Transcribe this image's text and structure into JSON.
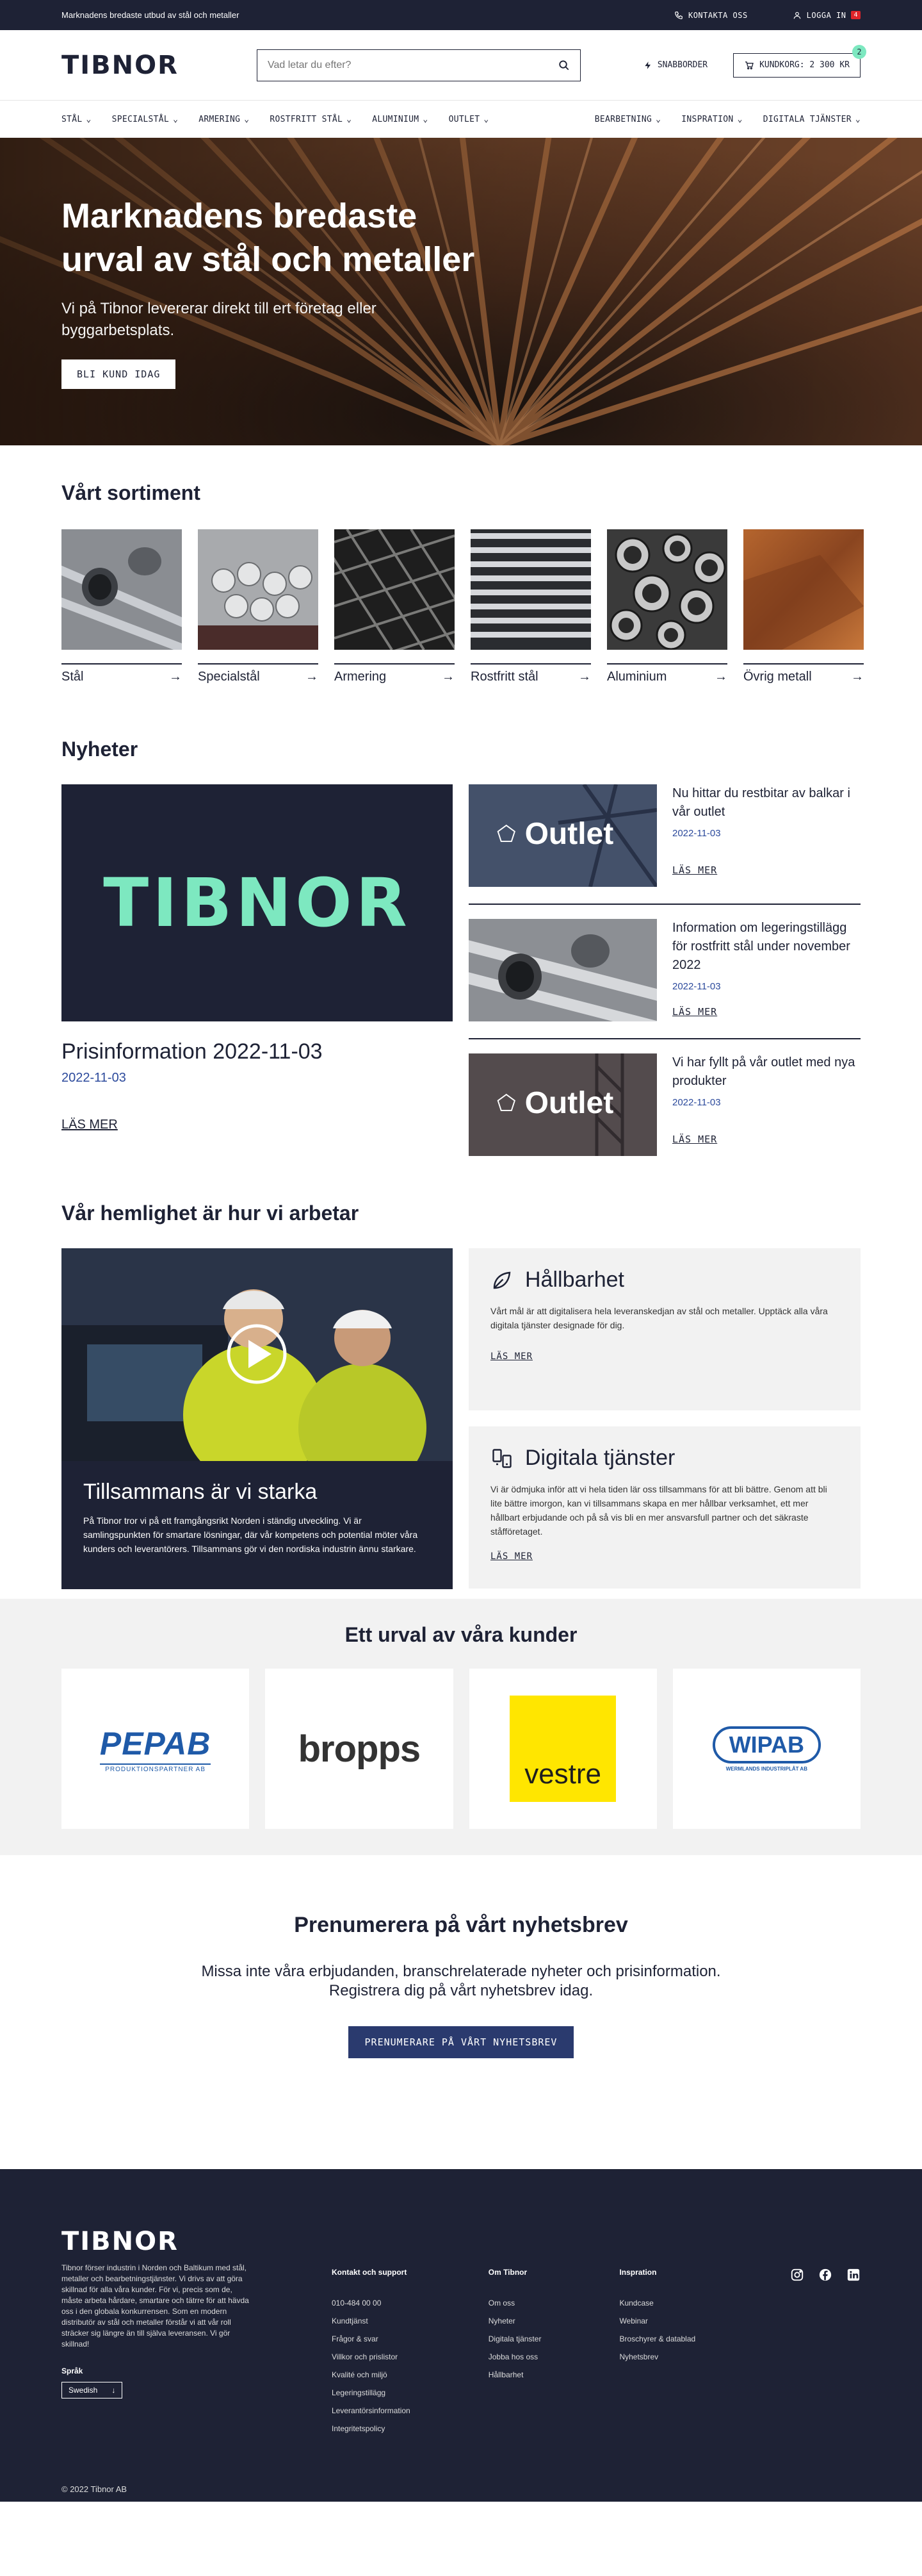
{
  "topbar": {
    "tagline": "Marknadens bredaste utbud av stål och metaller",
    "contact": "KONTAKTA OSS",
    "login": "LOGGA IN",
    "login_badge": "4"
  },
  "header": {
    "logo": "TIBNOR",
    "search_placeholder": "Vad letar du efter?",
    "quick_order": "SNABBORDER",
    "cart_label": "KUNDKORG: 2 300 KR",
    "cart_count": "2"
  },
  "nav": {
    "left": [
      "STÅL",
      "SPECIALSTÅL",
      "ARMERING",
      "ROSTFRITT STÅL",
      "ALUMINIUM",
      "OUTLET"
    ],
    "right": [
      "BEARBETNING",
      "INSPRATION",
      "DIGITALA TJÄNSTER"
    ]
  },
  "hero": {
    "title_1": "Marknadens bredaste",
    "title_2": "urval av stål och metaller",
    "text_1": "Vi på Tibnor levererar direkt till ert företag eller",
    "text_2": "byggarbetsplats.",
    "button": "BLI KUND IDAG"
  },
  "sortiment": {
    "title": "Vårt sortiment",
    "items": [
      "Stål",
      "Specialstål",
      "Armering",
      "Rostfritt stål",
      "Aluminium",
      "Övrig metall"
    ]
  },
  "news": {
    "title": "Nyheter",
    "main": {
      "logo": "TIBNOR",
      "headline": "Prisinformation 2022-11-03",
      "date": "2022-11-03",
      "read_more": "LÄS MER"
    },
    "items": [
      {
        "title": "Nu hittar du restbitar av balkar i vår outlet",
        "date": "2022-11-03",
        "read_more": "LÄS MER",
        "badge": "Outlet"
      },
      {
        "title": "Information om legeringstillägg för rostfritt stål under november 2022",
        "date": "2022-11-03",
        "read_more": "LÄS MER",
        "badge": ""
      },
      {
        "title": "Vi har fyllt på vår outlet med nya produkter",
        "date": "2022-11-03",
        "read_more": "LÄS MER",
        "badge": "Outlet"
      }
    ]
  },
  "secret": {
    "title": "Vår hemlighet är hur vi arbetar",
    "video_title": "Tillsammans är vi starka",
    "video_text": "På Tibnor tror vi på ett framgångsrikt Norden i ständig utveckling. Vi är samlingspunkten för smartare lösningar, där vår kompetens och potential möter våra kunders och leverantörers. Tillsammans gör vi den nordiska industrin ännu starkare.",
    "cards": [
      {
        "title": "Hållbarhet",
        "text": "Vårt mål är att digitalisera hela leveranskedjan av stål och metaller. Upptäck alla våra digitala tjänster designade för dig.",
        "link": "LÄS MER"
      },
      {
        "title": "Digitala tjänster",
        "text": "Vi är ödmjuka inför att vi hela tiden lär oss tillsammans för att bli bättre. Genom att bli lite bättre imorgon, kan vi tillsammans skapa en mer hållbar verksamhet, ett mer hållbart erbjudande och på så vis bli en mer ansvarsfull partner och det säkraste ståfföretaget.",
        "link": "LÄS MER"
      }
    ]
  },
  "customers": {
    "title": "Ett urval av våra kunder",
    "logos": [
      "PEPAB",
      "PRODUKTIONSPARTNER AB",
      "bropps",
      "vestre",
      "WIPAB",
      "WERMLANDS INDUSTRIPLÅT AB"
    ]
  },
  "newsletter": {
    "title": "Prenumerera på vårt nyhetsbrev",
    "text_1": "Missa inte våra erbjudanden, branschrelaterade nyheter och prisinformation.",
    "text_2": "Registrera dig på vårt nyhetsbrev idag.",
    "button": "PRENUMERARE PÅ VÅRT NYHETSBREV"
  },
  "footer": {
    "logo": "TIBNOR",
    "about": "Tibnor förser industrin i Norden och Baltikum med stål, metaller och bearbetningstjänster. Vi drivs av att göra skillnad för alla våra kunder. För vi, precis som de, måste arbeta hårdare, smartare och tätrre för att hävda oss i den globala konkurrensen. Som en modern distributör av stål och metaller förstår vi att vår roll sträcker sig längre än till själva leveransen. Vi gör skillnad!",
    "lang_label": "Språk",
    "lang_value": "Swedish",
    "cols": [
      {
        "title": "Kontakt och support",
        "links": [
          "010-484 00 00",
          "Kundtjänst",
          "Frågor & svar",
          "Villkor och prislistor",
          "Kvalité och miljö",
          "Legeringstillägg",
          "Leverantörsinformation",
          "Integritetspolicy"
        ]
      },
      {
        "title": "Om Tibnor",
        "links": [
          "Om oss",
          "Nyheter",
          "Digitala tjänster",
          "Jobba hos oss",
          "Hållbarhet"
        ]
      },
      {
        "title": "Inspration",
        "links": [
          "Kundcase",
          "Webinar",
          "Broschyrer & datablad",
          "Nyhetsbrev"
        ]
      }
    ],
    "copyright": "© 2022 Tibnor AB"
  }
}
